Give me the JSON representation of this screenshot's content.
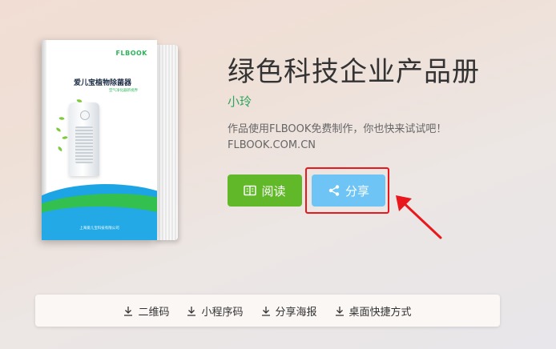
{
  "book": {
    "cover_logo": "FLBOOK",
    "cover_title": "爱儿宝植物除菌器",
    "cover_subtitle": "空气净化器新视界",
    "cover_company": "上海爱儿宝科技有限公司"
  },
  "title": "绿色科技企业产品册",
  "author": "小玲",
  "description_line1": "作品使用FLBOOK免费制作，你也快来试试吧！",
  "description_line2": "FLBOOK.COM.CN",
  "buttons": {
    "read_label": "阅读",
    "read_icon": "book-open-icon",
    "share_label": "分享",
    "share_icon": "share-icon",
    "read_color": "#61b828",
    "share_color": "#6ec5f5"
  },
  "annotation": {
    "highlight_color": "#e8181c"
  },
  "downloads": [
    {
      "label": "二维码",
      "icon": "download-icon"
    },
    {
      "label": "小程序码",
      "icon": "download-icon"
    },
    {
      "label": "分享海报",
      "icon": "download-icon"
    },
    {
      "label": "桌面快捷方式",
      "icon": "download-icon"
    }
  ]
}
